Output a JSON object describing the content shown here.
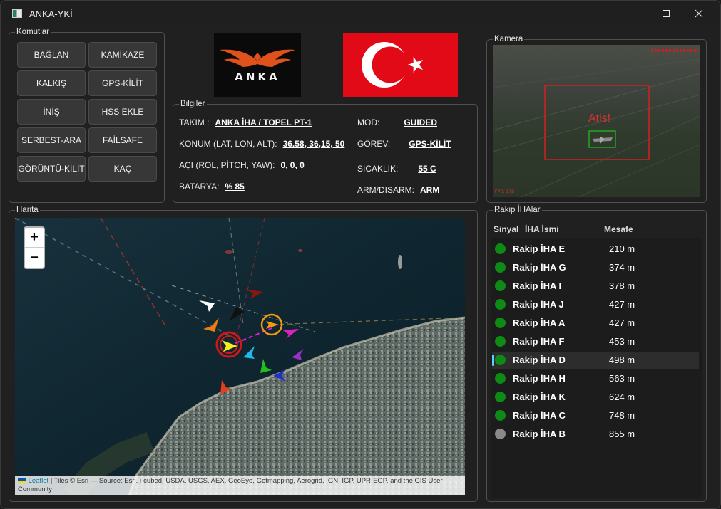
{
  "window": {
    "title": "ANKA-YKİ"
  },
  "commands": {
    "title": "Komutlar",
    "buttons": [
      "BAĞLAN",
      "KAMİKAZE",
      "KALKIŞ",
      "GPS-KİLİT",
      "İNİŞ",
      "HSS EKLE",
      "SERBEST-ARA",
      "FAİLSAFE",
      "GÖRÜNTÜ-KİLİT",
      "KAÇ"
    ]
  },
  "logo": {
    "text": "ANKA"
  },
  "info": {
    "title": "Bilgiler",
    "team_label": "TAKIM :",
    "team_value": "ANKA İHA / TOPEL PT-1",
    "position_label": "KONUM (LAT, LON, ALT):",
    "position_value": "36.58, 36,15, 50",
    "angle_label": "AÇI (ROL, PİTCH, YAW):",
    "angle_value": "0, 0, 0",
    "battery_label": "BATARYA:",
    "battery_value": "% 85",
    "mode_label": "MOD:",
    "mode_value": "GUIDED",
    "task_label": "GÖREV:",
    "task_value": "GPS-KİLİT",
    "temp_label": "SICAKLIK:",
    "temp_value": "55 C",
    "arm_label": "ARM/DISARM:",
    "arm_value": "ARM"
  },
  "camera": {
    "title": "Kamera",
    "overlay_text": "Atis!",
    "fps_text": "FPS: 8.78"
  },
  "map": {
    "title": "Harita",
    "zoom_in": "+",
    "zoom_out": "−",
    "attribution_link": "Leaflet",
    "attribution_text": "| Tiles © Esri — Source: Esri, i-cubed, USDA, USGS, AEX, GeoEye, Getmapping, Aerogrid, IGN, IGP, UPR-EGP, and the GIS User Community"
  },
  "rivals": {
    "title": "Rakip İHAlar",
    "headers": {
      "signal": "Sinyal",
      "name": "İHA İsmi",
      "distance": "Mesafe"
    },
    "items": [
      {
        "name": "Rakip İHA E",
        "distance": "210 m",
        "signal": "green"
      },
      {
        "name": "Rakip İHA G",
        "distance": "374 m",
        "signal": "green"
      },
      {
        "name": "Rakip İHA I",
        "distance": "378 m",
        "signal": "green"
      },
      {
        "name": "Rakip İHA J",
        "distance": "427 m",
        "signal": "green"
      },
      {
        "name": "Rakip İHA A",
        "distance": "427 m",
        "signal": "green"
      },
      {
        "name": "Rakip İHA F",
        "distance": "453 m",
        "signal": "green"
      },
      {
        "name": "Rakip İHA D",
        "distance": "498 m",
        "signal": "green"
      },
      {
        "name": "Rakip İHA H",
        "distance": "563 m",
        "signal": "green"
      },
      {
        "name": "Rakip İHA K",
        "distance": "624 m",
        "signal": "green"
      },
      {
        "name": "Rakip İHA C",
        "distance": "748 m",
        "signal": "green"
      },
      {
        "name": "Rakip İHA B",
        "distance": "855 m",
        "signal": "gray"
      }
    ],
    "selected_index": 6
  },
  "colors": {
    "signal_green": "#0e8a16",
    "signal_gray": "#8a8a8a",
    "accent": "#60cdff",
    "flag_red": "#e30a17"
  }
}
